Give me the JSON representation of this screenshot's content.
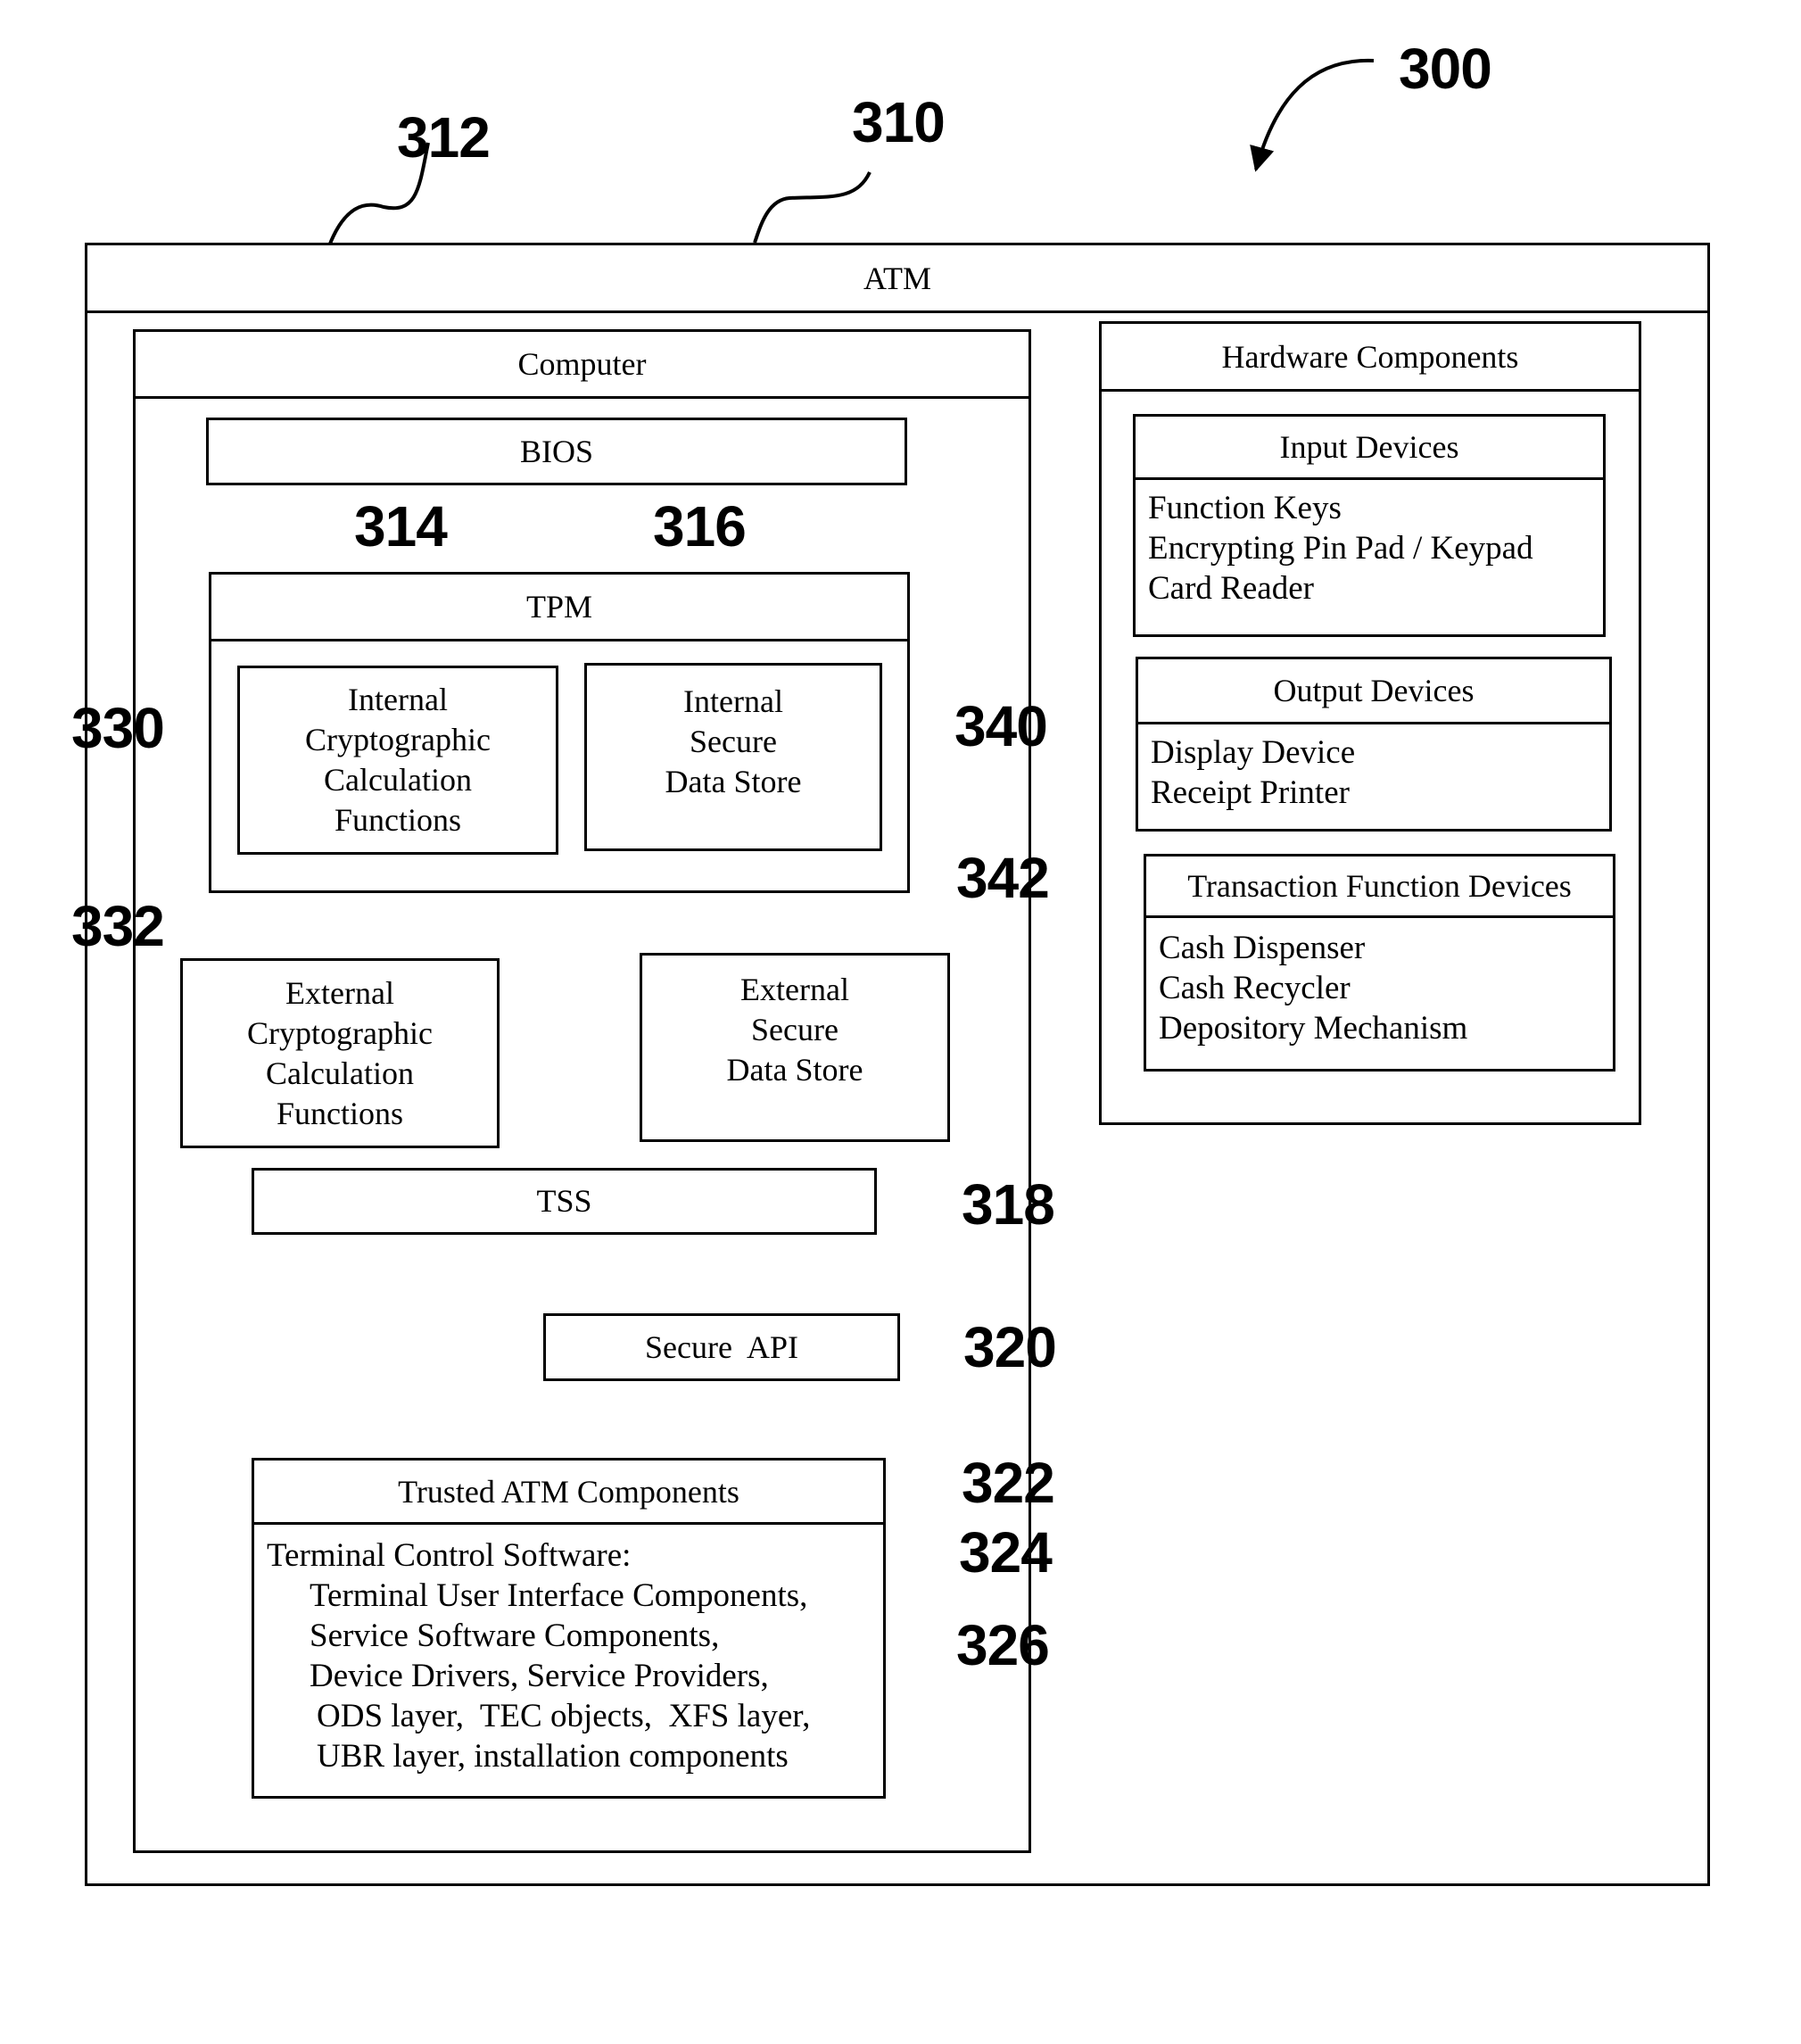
{
  "figure": {
    "number": "300",
    "atm": {
      "label": "ATM",
      "ref": "310"
    },
    "computer": {
      "label": "Computer",
      "ref": "312"
    },
    "bios": {
      "label": "BIOS",
      "ref": "316"
    },
    "tpm": {
      "label": "TPM",
      "ref": "314"
    },
    "internal_crypto": {
      "lines": [
        "Internal",
        "Cryptographic",
        "Calculation",
        "Functions"
      ],
      "ref": "330"
    },
    "internal_store": {
      "lines": [
        "Internal",
        "Secure",
        "Data Store"
      ],
      "ref": "340"
    },
    "external_crypto": {
      "lines": [
        "External",
        "Cryptographic",
        "Calculation",
        "Functions"
      ],
      "ref": "332"
    },
    "external_store": {
      "lines": [
        "External",
        "Secure",
        "Data Store"
      ],
      "ref": "342"
    },
    "tss": {
      "label": "TSS",
      "ref": "318"
    },
    "secure_api": {
      "label": "Secure  API",
      "ref": "320"
    },
    "trusted": {
      "label": "Trusted ATM Components",
      "ref": "322",
      "lines": [
        "Terminal Control Software:",
        "Terminal User Interface Components,",
        "Service Software Components,",
        "Device Drivers, Service Providers,",
        "ODS layer,  TEC objects,  XFS layer,",
        "UBR layer, installation components"
      ],
      "ref_tcs": "324",
      "ref_ssc": "326"
    },
    "hardware": {
      "label": "Hardware Components",
      "groups": [
        {
          "title": "Input Devices",
          "items": [
            "Function Keys",
            "Encrypting Pin Pad / Keypad",
            "Card Reader"
          ]
        },
        {
          "title": "Output Devices",
          "items": [
            "Display Device",
            "Receipt Printer"
          ]
        },
        {
          "title": "Transaction Function Devices",
          "items": [
            "Cash Dispenser",
            "Cash Recycler",
            "Depository Mechanism"
          ]
        }
      ]
    }
  }
}
